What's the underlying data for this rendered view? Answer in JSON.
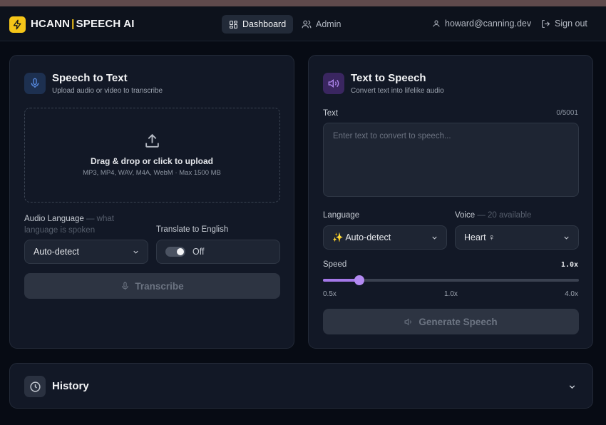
{
  "header": {
    "brand_left": "HCANN",
    "brand_sep": "|",
    "brand_right": "SPEECH AI",
    "nav": [
      {
        "label": "Dashboard",
        "icon": "dashboard-grid-icon",
        "active": true
      },
      {
        "label": "Admin",
        "icon": "users-icon",
        "active": false
      }
    ],
    "user_email": "howard@canning.dev",
    "signout_label": "Sign out"
  },
  "stt": {
    "title": "Speech to Text",
    "subtitle": "Upload audio or video to transcribe",
    "dropzone_title": "Drag & drop or click to upload",
    "dropzone_formats": "MP3, MP4, WAV, M4A, WebM · Max 1500 MB",
    "language_label": "Audio Language",
    "language_hint_line1": "— what",
    "language_hint_line2": "language is spoken",
    "language_value": "Auto-detect",
    "translate_label": "Translate to English",
    "translate_value": "Off",
    "transcribe_label": "Transcribe"
  },
  "tts": {
    "title": "Text to Speech",
    "subtitle": "Convert text into lifelike audio",
    "text_label": "Text",
    "text_counter": "0/5001",
    "text_placeholder": "Enter text to convert to speech...",
    "language_label": "Language",
    "language_value": "✨ Auto-detect",
    "voice_label": "Voice",
    "voice_hint": "— 20 available",
    "voice_value": "Heart ♀",
    "speed_label": "Speed",
    "speed_value": "1.0x",
    "speed_min": "0.5x",
    "speed_mid": "1.0x",
    "speed_max": "4.0x",
    "speed_level": 0.143,
    "generate_label": "Generate Speech"
  },
  "history": {
    "title": "History"
  },
  "colors": {
    "accent_yellow": "#f5c518",
    "stt_accent": "#4f7fd9",
    "tts_accent": "#a478e8",
    "background": "#070b14",
    "card": "#121826"
  }
}
